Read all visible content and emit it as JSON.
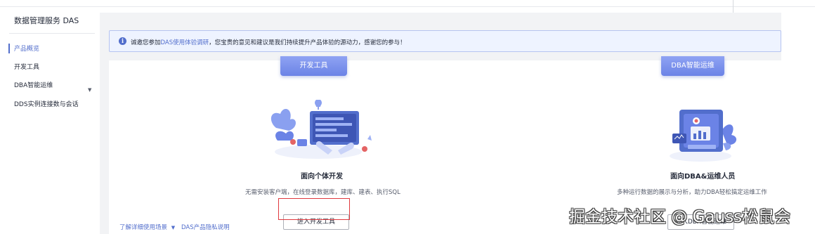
{
  "sidebar": {
    "title": "数据管理服务 DAS",
    "items": [
      {
        "label": "产品概览"
      },
      {
        "label": "开发工具"
      },
      {
        "label": "DBA智能运维"
      },
      {
        "label": "DDS实例连接数与会话"
      }
    ],
    "active_index": 0
  },
  "notice": {
    "prefix": "诚邀您参加",
    "link": "DAS使用体验调研",
    "suffix": "，您宝贵的意见和建议是我们持续提升产品体验的源动力，感谢您的参与！"
  },
  "cards": [
    {
      "tab_label": "开发工具",
      "title": "面向个体开发",
      "description": "无需安装客户端，在线登录数据库，建库、建表、执行SQL",
      "button_label": "进入开发工具"
    },
    {
      "tab_label": "DBA智能运维",
      "title": "面向DBA&运维人员",
      "description": "多种运行数据的展示与分析，助力DBA轻松搞定运维工作",
      "button_label": "进入DBA智能运维"
    }
  ],
  "footer_links": {
    "scenarios": "了解详细使用场景",
    "privacy": "DAS产品隐私说明"
  },
  "watermark": "掘金技术社区 @ Gauss松鼠会",
  "colors": {
    "accent": "#526ecc",
    "highlight": "#e0393e",
    "main_bg": "#f2f3f5"
  }
}
